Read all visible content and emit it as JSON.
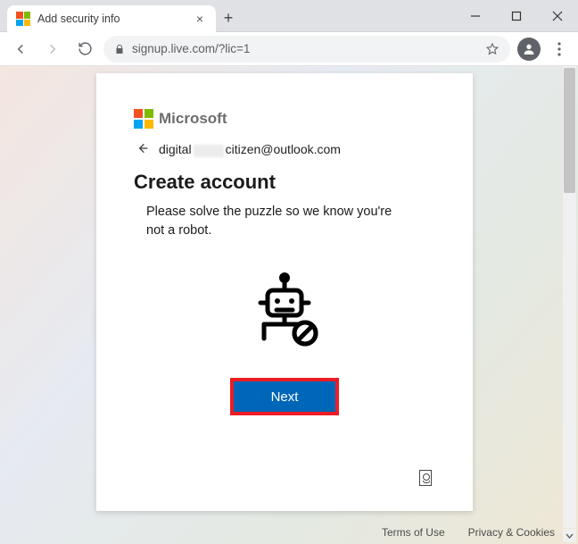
{
  "window": {
    "tab_title": "Add security info",
    "close_glyph": "×",
    "new_tab_glyph": "+"
  },
  "toolbar": {
    "url": "signup.live.com/?lic=1"
  },
  "card": {
    "brand": "Microsoft",
    "email_prefix": "digital",
    "email_suffix": "citizen@outlook.com",
    "heading": "Create account",
    "description": "Please solve the puzzle so we know you're not a robot.",
    "next_label": "Next"
  },
  "footer": {
    "terms": "Terms of Use",
    "privacy": "Privacy & Cookies"
  },
  "colors": {
    "accent": "#0067b8",
    "highlight_border": "#ed1c24"
  }
}
